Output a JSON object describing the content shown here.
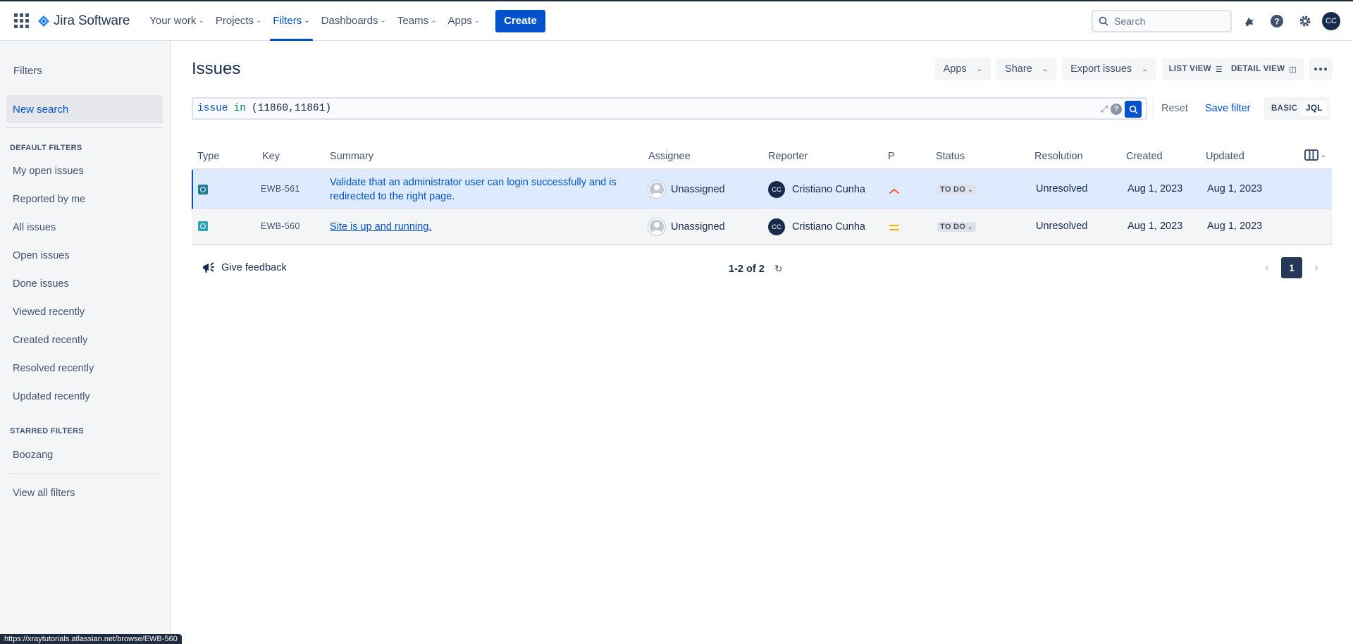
{
  "nav": {
    "brand": "Jira Software",
    "items": [
      {
        "label": "Your work",
        "active": false
      },
      {
        "label": "Projects",
        "active": false
      },
      {
        "label": "Filters",
        "active": true
      },
      {
        "label": "Dashboards",
        "active": false
      },
      {
        "label": "Teams",
        "active": false
      },
      {
        "label": "Apps",
        "active": false
      }
    ],
    "create_label": "Create",
    "search_placeholder": "Search",
    "user_initials": "CC",
    "icons": [
      "notifications-icon",
      "help-icon",
      "settings-icon"
    ]
  },
  "sidebar": {
    "title": "Filters",
    "new_search": "New search",
    "default_heading": "DEFAULT FILTERS",
    "default_items": [
      "My open issues",
      "Reported by me",
      "All issues",
      "Open issues",
      "Done issues",
      "Viewed recently",
      "Created recently",
      "Resolved recently",
      "Updated recently"
    ],
    "starred_heading": "STARRED FILTERS",
    "starred_items": [
      "Boozang"
    ],
    "view_all": "View all filters"
  },
  "main": {
    "title": "Issues",
    "toolbar": {
      "apps": "Apps",
      "share": "Share",
      "export": "Export issues",
      "list_view": "LIST VIEW",
      "detail_view": "DETAIL VIEW"
    },
    "jql": {
      "keyword": "issue",
      "operator": "in",
      "value": "(11860,11861)"
    },
    "reset": "Reset",
    "save_filter": "Save filter",
    "mode_basic": "BASIC",
    "mode_jql": "JQL",
    "table": {
      "headers": {
        "type": "Type",
        "key": "Key",
        "summary": "Summary",
        "assignee": "Assignee",
        "reporter": "Reporter",
        "priority": "P",
        "status": "Status",
        "resolution": "Resolution",
        "created": "Created",
        "updated": "Updated"
      },
      "rows": [
        {
          "key": "EWB-561",
          "summary": "Validate that an administrator user can login successfully and is redirected to the right page.",
          "assignee": "Unassigned",
          "reporter": "Cristiano Cunha",
          "reporter_initials": "CC",
          "priority": "high",
          "status": "TO DO",
          "resolution": "Unresolved",
          "created": "Aug 1, 2023",
          "updated": "Aug 1, 2023"
        },
        {
          "key": "EWB-560",
          "summary": "Site is up and running.",
          "assignee": "Unassigned",
          "reporter": "Cristiano Cunha",
          "reporter_initials": "CC",
          "priority": "medium",
          "status": "TO DO",
          "resolution": "Unresolved",
          "created": "Aug 1, 2023",
          "updated": "Aug 1, 2023"
        }
      ]
    },
    "footer": {
      "feedback": "Give feedback",
      "count": "1-2 of 2",
      "current_page": "1"
    }
  },
  "status_bar_url": "https://xraytutorials.atlassian.net/browse/EWB-560",
  "colors": {
    "accent": "#0052cc",
    "priority_high": "#ff5630",
    "priority_medium": "#ffab00",
    "selected_row": "#deebff"
  }
}
